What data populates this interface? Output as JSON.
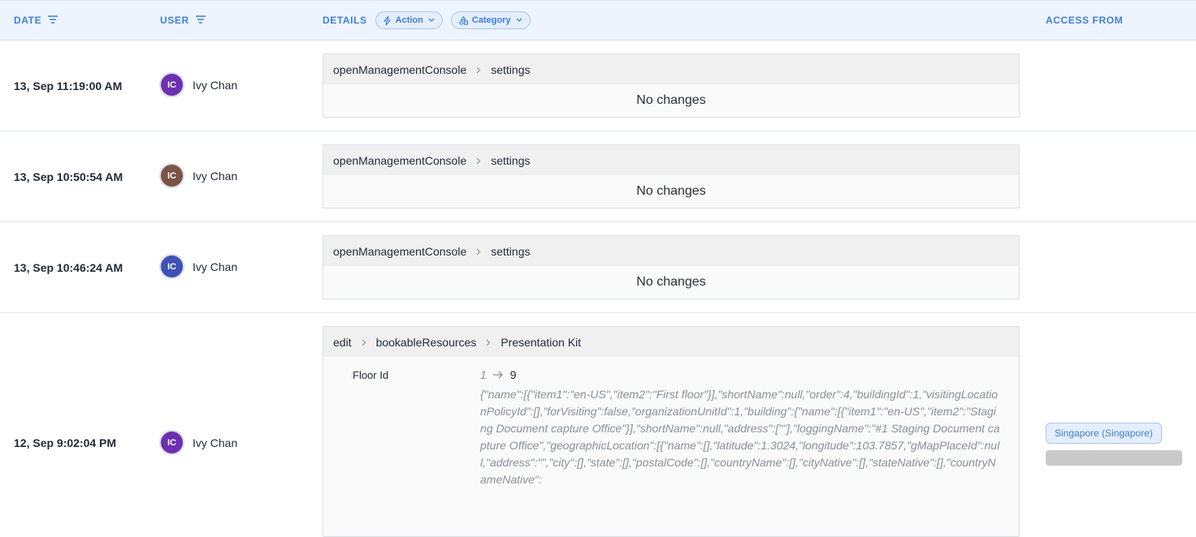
{
  "header": {
    "date": "DATE",
    "user": "USER",
    "details": "DETAILS",
    "action_filter": "Action",
    "category_filter": "Category",
    "access_from": "ACCESS FROM"
  },
  "rows": [
    {
      "date": "13, Sep 11:19:00 AM",
      "initials": "IC",
      "avatar_color": "#6d2fb0",
      "user": "Ivy Chan",
      "crumbs": [
        "openManagementConsole",
        "settings"
      ],
      "note": "No changes"
    },
    {
      "date": "13, Sep 10:50:54 AM",
      "initials": "IC",
      "avatar_color": "#7a5446",
      "user": "Ivy Chan",
      "crumbs": [
        "openManagementConsole",
        "settings"
      ],
      "note": "No changes"
    },
    {
      "date": "13, Sep 10:46:24 AM",
      "initials": "IC",
      "avatar_color": "#3f51b5",
      "user": "Ivy Chan",
      "crumbs": [
        "openManagementConsole",
        "settings"
      ],
      "note": "No changes"
    },
    {
      "date": "12, Sep 9:02:04 PM",
      "initials": "IC",
      "avatar_color": "#6d2fb0",
      "user": "Ivy Chan",
      "crumbs": [
        "edit",
        "bookableResources",
        "Presentation Kit"
      ],
      "field_label": "Floor Id",
      "old_value": "1",
      "new_value": "9",
      "json_text": "{\"name\":[{\"item1\":\"en-US\",\"item2\":\"First floor\"}],\"shortName\":null,\"order\":4,\"buildingId\":1,\"visitingLocationPolicyId\":[],\"forVisiting\":false,\"organizationUnitId\":1,\"building\":{\"name\":[{\"item1\":\"en-US\",\"item2\":\"Staging Document capture Office\"}],\"shortName\":null,\"address\":[\"\"],\"loggingName\":\"#1 Staging Document capture Office\",\"geographicLocation\":[{\"name\":[],\"latitude\":1.3024,\"longitude\":103.7857,\"gMapPlaceId\":null,\"address\":\"\",\"city\":[],\"state\":[],\"postalCode\":[],\"countryName\":[],\"cityNative\":[],\"stateNative\":[],\"countryNameNative\":",
      "access_location": "Singapore (Singapore)"
    }
  ],
  "colors": {
    "accent": "#3f7fd6",
    "header_bg": "#eef4fd",
    "pill_bg": "#e4eefc"
  }
}
